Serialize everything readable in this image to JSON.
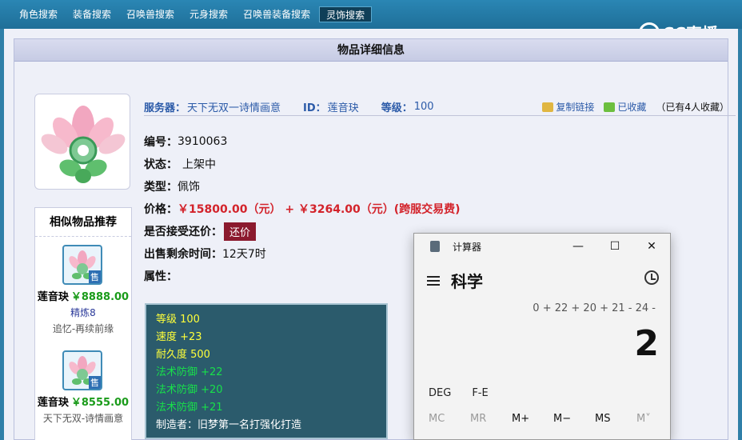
{
  "nav": {
    "tabs": [
      "角色搜索",
      "装备搜索",
      "召唤兽搜索",
      "元身搜索",
      "召唤兽装备搜索",
      "灵饰搜索"
    ],
    "active_index": 5
  },
  "logo": {
    "text": "CC直播"
  },
  "panel": {
    "title": "物品详细信息"
  },
  "meta": {
    "server_label": "服务器：",
    "server_value": "天下无双一诗情画意",
    "id_label": "ID：",
    "id_value": "莲音玦",
    "level_label": "等级：",
    "level_value": "100",
    "copy_link": "复制链接",
    "favorited": "已收藏",
    "fav_count": "（已有4人收藏）"
  },
  "details": {
    "number_label": "编号：",
    "number_value": "3910063",
    "status_label": "状态：",
    "status_value": "上架中",
    "type_label": "类型：",
    "type_value": "佩饰",
    "price_label": "价格：",
    "price_value": "￥15800.00（元） + ￥3264.00（元）(跨服交易费)",
    "counter_label": "是否接受还价：",
    "counter_button": "还价",
    "time_label": "出售剩余时间：",
    "time_value": "12天7时",
    "attr_label": "属性："
  },
  "attributes": [
    {
      "text": "等级 100",
      "color": "#ffff3a"
    },
    {
      "text": "速度 +23",
      "color": "#ffff3a"
    },
    {
      "text": "耐久度 500",
      "color": "#ffff3a"
    },
    {
      "text": "法术防御 +22",
      "color": "#18e04a"
    },
    {
      "text": "法术防御 +20",
      "color": "#18e04a"
    },
    {
      "text": "法术防御 +21",
      "color": "#18e04a"
    },
    {
      "text": "制造者：旧梦第一名打强化打造",
      "color": "#ffffff"
    }
  ],
  "similar": {
    "title": "相似物品推荐",
    "items": [
      {
        "name": "莲音玦",
        "price": "￥8888.00",
        "sub": "精炼8",
        "desc": "追忆-再续前缘",
        "badge": "售"
      },
      {
        "name": "莲音玦",
        "price": "￥8555.00",
        "sub": "",
        "desc": "天下无双-诗情画意",
        "badge": "售"
      }
    ]
  },
  "calculator": {
    "title": "计算器",
    "mode": "科学",
    "expression": "0 + 22 + 20 + 21 - 24 -",
    "result": "2",
    "row1": [
      "DEG",
      "F-E"
    ],
    "memory": [
      "MC",
      "MR",
      "M+",
      "M−",
      "MS",
      "M˅"
    ],
    "memory_disabled": [
      true,
      true,
      false,
      false,
      false,
      true
    ],
    "window_buttons": [
      "—",
      "☐",
      "✕"
    ]
  }
}
